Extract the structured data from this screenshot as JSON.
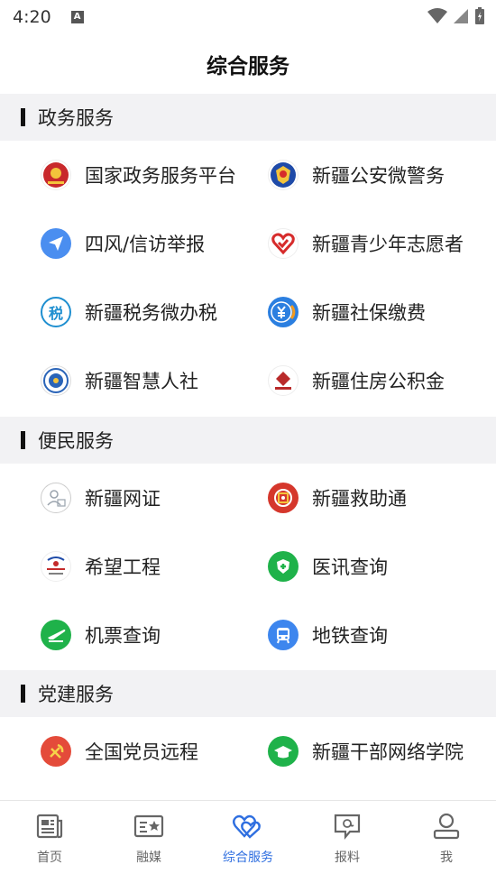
{
  "status_bar": {
    "time": "4:20",
    "notification_letter": "A"
  },
  "page": {
    "title": "综合服务"
  },
  "sections": [
    {
      "title": "政务服务",
      "items": [
        {
          "label": "国家政务服务平台",
          "icon": "national-emblem-icon",
          "color": "#c8282b"
        },
        {
          "label": "新疆公安微警务",
          "icon": "police-badge-icon",
          "color": "#1e4aa8"
        },
        {
          "label": "四风/信访举报",
          "icon": "paper-plane-icon",
          "color": "#4a8ef0"
        },
        {
          "label": "新疆青少年志愿者",
          "icon": "heart-volunteer-icon",
          "color": "#d62b2b"
        },
        {
          "label": "新疆税务微办税",
          "icon": "tax-icon",
          "color": "#1f8fd0"
        },
        {
          "label": "新疆社保缴费",
          "icon": "yuan-coin-icon",
          "color": "#2b7fe0"
        },
        {
          "label": "新疆智慧人社",
          "icon": "hrss-emblem-icon",
          "color": "#2a64b8"
        },
        {
          "label": "新疆住房公积金",
          "icon": "housing-fund-icon",
          "color": "#b92a2a"
        }
      ]
    },
    {
      "title": "便民服务",
      "items": [
        {
          "label": "新疆网证",
          "icon": "id-card-icon",
          "color": "#9aa3ad"
        },
        {
          "label": "新疆救助通",
          "icon": "rescue-icon",
          "color": "#d5372c"
        },
        {
          "label": "希望工程",
          "icon": "project-hope-icon",
          "color": "#c42b2b"
        },
        {
          "label": "医讯查询",
          "icon": "medical-shield-icon",
          "color": "#1fb24a"
        },
        {
          "label": "机票查询",
          "icon": "airplane-icon",
          "color": "#1fb24a"
        },
        {
          "label": "地铁查询",
          "icon": "metro-bus-icon",
          "color": "#3d86ee"
        }
      ]
    },
    {
      "title": "党建服务",
      "items": [
        {
          "label": "全国党员远程",
          "icon": "party-emblem-icon",
          "color": "#e44b3a"
        },
        {
          "label": "新疆干部网络学院",
          "icon": "graduation-cap-icon",
          "color": "#1fb24a"
        }
      ]
    }
  ],
  "tabs": [
    {
      "label": "首页",
      "icon": "home-news-icon",
      "active": false
    },
    {
      "label": "融媒",
      "icon": "media-card-icon",
      "active": false
    },
    {
      "label": "综合服务",
      "icon": "hearts-icon",
      "active": true
    },
    {
      "label": "报料",
      "icon": "report-chat-icon",
      "active": false
    },
    {
      "label": "我",
      "icon": "user-icon",
      "active": false
    }
  ],
  "colors": {
    "accent": "#2f6fe0",
    "section_bg": "#f2f2f4"
  }
}
